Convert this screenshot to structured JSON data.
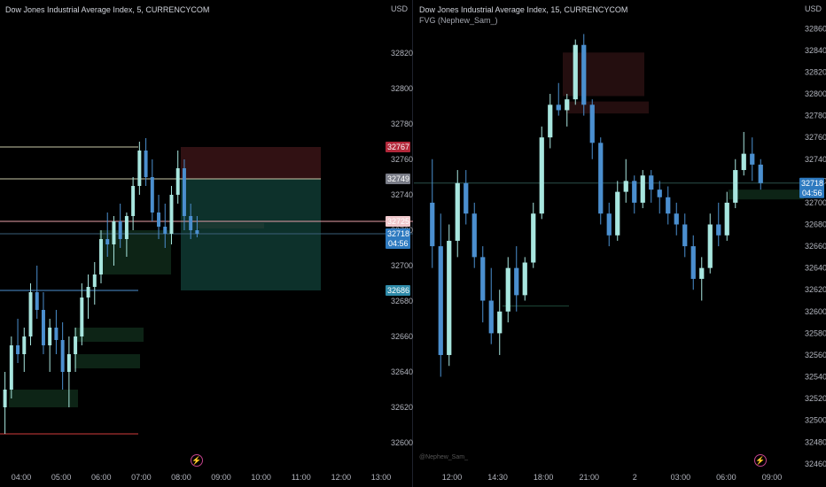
{
  "left_chart": {
    "title": "Dow Jones Industrial Average Index, 5, CURRENCYCOM",
    "currency": "USD",
    "price_axis": [
      "32820",
      "32800",
      "32780",
      "32760",
      "32740",
      "32720",
      "32700",
      "32680",
      "32660",
      "32640",
      "32620",
      "32600"
    ],
    "time_axis": [
      "04:00",
      "05:00",
      "06:00",
      "07:00",
      "08:00",
      "09:00",
      "10:00",
      "11:00",
      "12:00",
      "13:00"
    ],
    "price_tags": {
      "stop": "32767",
      "upper": "32749",
      "entry": "32725",
      "last": "32718",
      "countdown": "04:56",
      "target": "32686"
    },
    "colors": {
      "up": "#a8e6df",
      "down": "#4b8fcf",
      "stop_zone": "#3a1416",
      "target_zone": "#0f3a33",
      "fvg": "#0f2a1a"
    }
  },
  "right_chart": {
    "title": "Dow Jones Industrial Average Index, 15, CURRENCYCOM",
    "indicator": "FVG (Nephew_Sam_)",
    "currency": "USD",
    "watermark": "@Nephew_Sam_",
    "price_axis": [
      "32860",
      "32840",
      "32820",
      "32800",
      "32780",
      "32760",
      "32740",
      "32720",
      "32700",
      "32680",
      "32660",
      "32640",
      "32620",
      "32600",
      "32580",
      "32560",
      "32540",
      "32520",
      "32500",
      "32480",
      "32460"
    ],
    "time_axis": [
      "12:00",
      "14:30",
      "18:00",
      "21:00",
      "2",
      "03:00",
      "06:00",
      "09:00"
    ],
    "price_tags": {
      "last": "32718",
      "countdown": "04:56"
    },
    "colors": {
      "up": "#a8e6df",
      "down": "#4b8fcf",
      "bear_fvg": "#2a1012",
      "bull_fvg": "#0f2a1a"
    }
  },
  "chart_data": [
    {
      "type": "candlestick",
      "title": "Dow Jones Industrial Average Index, 5, CURRENCYCOM",
      "interval": "5",
      "ylim": [
        32595,
        32830
      ],
      "x": [
        "04:00",
        "05:00",
        "06:00",
        "07:00",
        "08:00",
        "09:00",
        "10:00",
        "11:00",
        "12:00",
        "13:00"
      ],
      "last_price": 32718,
      "levels": [
        32767,
        32749,
        32725,
        32686
      ],
      "candles": [
        [
          32620,
          32640,
          32605,
          32630
        ],
        [
          32630,
          32660,
          32625,
          32655
        ],
        [
          32655,
          32670,
          32645,
          32650
        ],
        [
          32650,
          32665,
          32640,
          32660
        ],
        [
          32660,
          32690,
          32655,
          32685
        ],
        [
          32685,
          32700,
          32670,
          32675
        ],
        [
          32675,
          32685,
          32650,
          32655
        ],
        [
          32655,
          32670,
          32640,
          32665
        ],
        [
          32665,
          32675,
          32650,
          32658
        ],
        [
          32658,
          32668,
          32630,
          32640
        ],
        [
          32640,
          32660,
          32620,
          32650
        ],
        [
          32650,
          32665,
          32640,
          32660
        ],
        [
          32660,
          32690,
          32655,
          32682
        ],
        [
          32682,
          32695,
          32670,
          32688
        ],
        [
          32688,
          32702,
          32678,
          32695
        ],
        [
          32695,
          32720,
          32690,
          32715
        ],
        [
          32715,
          32730,
          32705,
          32712
        ],
        [
          32712,
          32728,
          32700,
          32725
        ],
        [
          32725,
          32735,
          32710,
          32715
        ],
        [
          32715,
          32730,
          32705,
          32728
        ],
        [
          32728,
          32750,
          32720,
          32745
        ],
        [
          32745,
          32770,
          32740,
          32765
        ],
        [
          32765,
          32772,
          32745,
          32750
        ],
        [
          32750,
          32760,
          32725,
          32730
        ],
        [
          32730,
          32740,
          32715,
          32722
        ],
        [
          32722,
          32735,
          32710,
          32718
        ],
        [
          32718,
          32745,
          32712,
          32740
        ],
        [
          32740,
          32765,
          32735,
          32755
        ],
        [
          32755,
          32760,
          32720,
          32728
        ],
        [
          32728,
          32735,
          32715,
          32720
        ],
        [
          32720,
          32728,
          32716,
          32718
        ]
      ]
    },
    {
      "type": "candlestick",
      "title": "Dow Jones Industrial Average Index, 15, CURRENCYCOM",
      "interval": "15",
      "ylim": [
        32455,
        32870
      ],
      "x": [
        "12:00",
        "14:30",
        "18:00",
        "21:00",
        "2",
        "03:00",
        "06:00",
        "09:00"
      ],
      "last_price": 32718,
      "candles": [
        [
          32700,
          32740,
          32640,
          32660
        ],
        [
          32660,
          32690,
          32540,
          32560
        ],
        [
          32560,
          32680,
          32550,
          32665
        ],
        [
          32665,
          32730,
          32650,
          32718
        ],
        [
          32718,
          32730,
          32680,
          32690
        ],
        [
          32690,
          32700,
          32640,
          32650
        ],
        [
          32650,
          32660,
          32590,
          32610
        ],
        [
          32610,
          32640,
          32570,
          32580
        ],
        [
          32580,
          32620,
          32560,
          32600
        ],
        [
          32600,
          32650,
          32590,
          32640
        ],
        [
          32640,
          32660,
          32600,
          32615
        ],
        [
          32615,
          32650,
          32610,
          32645
        ],
        [
          32645,
          32700,
          32640,
          32690
        ],
        [
          32690,
          32770,
          32685,
          32760
        ],
        [
          32760,
          32800,
          32750,
          32790
        ],
        [
          32790,
          32810,
          32780,
          32785
        ],
        [
          32785,
          32800,
          32770,
          32795
        ],
        [
          32795,
          32850,
          32790,
          32845
        ],
        [
          32845,
          32855,
          32780,
          32790
        ],
        [
          32790,
          32795,
          32740,
          32755
        ],
        [
          32755,
          32760,
          32680,
          32690
        ],
        [
          32690,
          32700,
          32660,
          32670
        ],
        [
          32670,
          32720,
          32665,
          32710
        ],
        [
          32710,
          32740,
          32700,
          32720
        ],
        [
          32720,
          32725,
          32690,
          32700
        ],
        [
          32700,
          32730,
          32695,
          32725
        ],
        [
          32725,
          32730,
          32700,
          32712
        ],
        [
          32712,
          32720,
          32690,
          32705
        ],
        [
          32705,
          32715,
          32680,
          32690
        ],
        [
          32690,
          32700,
          32670,
          32680
        ],
        [
          32680,
          32690,
          32650,
          32660
        ],
        [
          32660,
          32670,
          32620,
          32630
        ],
        [
          32630,
          32650,
          32610,
          32640
        ],
        [
          32640,
          32690,
          32635,
          32680
        ],
        [
          32680,
          32700,
          32660,
          32670
        ],
        [
          32670,
          32710,
          32665,
          32700
        ],
        [
          32700,
          32740,
          32695,
          32730
        ],
        [
          32730,
          32765,
          32725,
          32745
        ],
        [
          32745,
          32760,
          32720,
          32735
        ],
        [
          32735,
          32740,
          32712,
          32718
        ]
      ]
    }
  ]
}
